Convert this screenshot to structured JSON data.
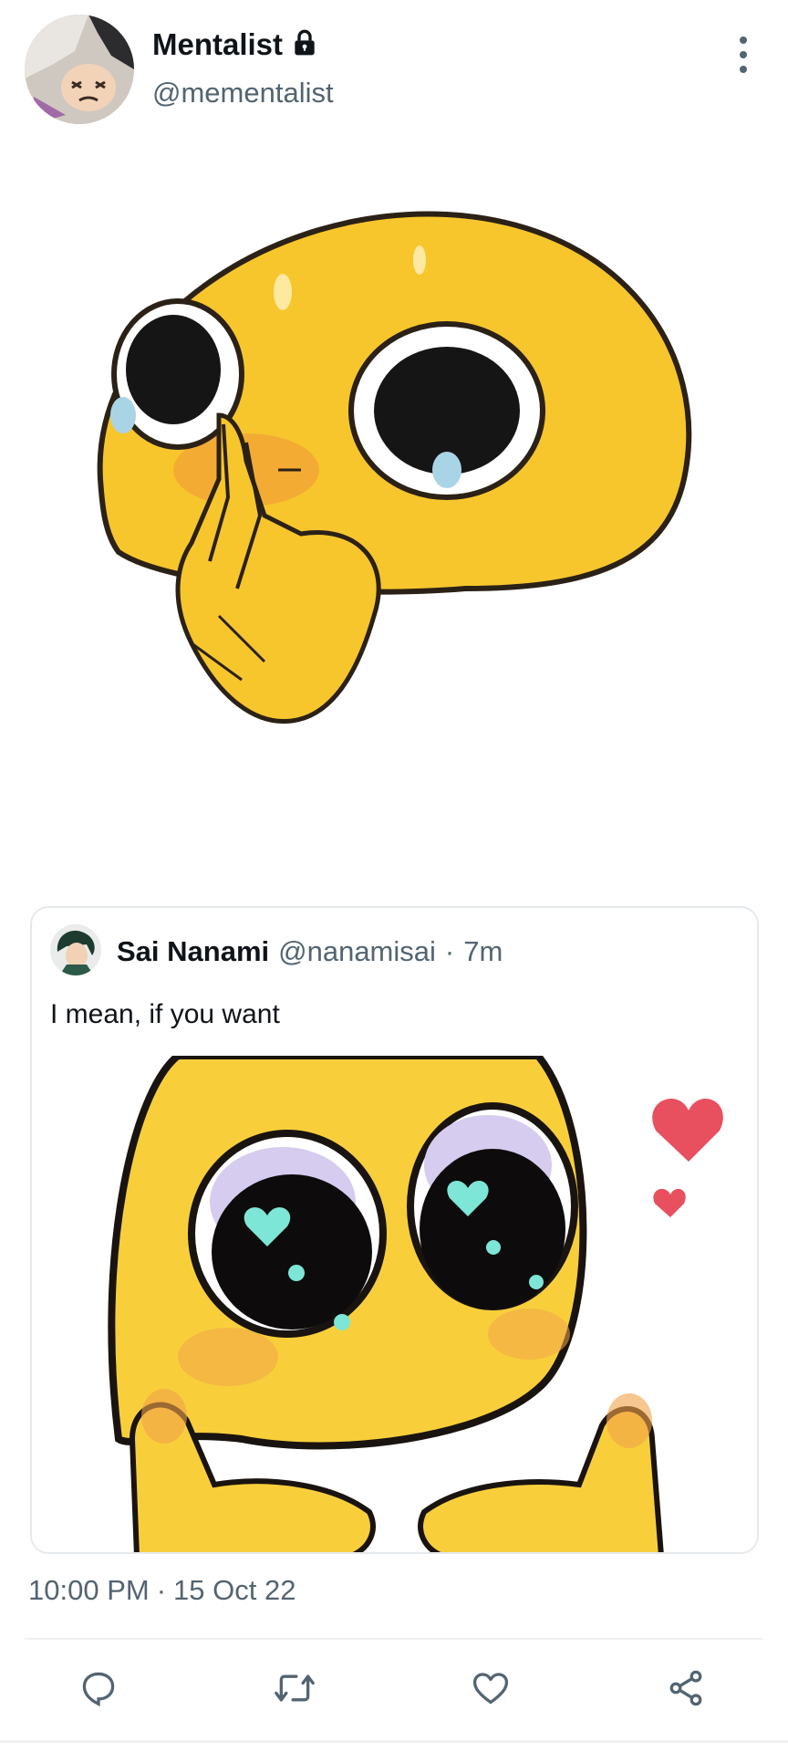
{
  "author": {
    "display_name": "Mentalist",
    "handle": "@mementalist",
    "protected": true,
    "icon": "lock-icon"
  },
  "menu": {
    "icon": "more-vertical-icon"
  },
  "main_image": {
    "subject": "yellow blob emoji with big teary eyes pressing hands together"
  },
  "quote": {
    "display_name": "Sai Nanami",
    "handle": "@nanamisai",
    "separator": "·",
    "time": "7m",
    "text": "I mean, if you want",
    "image": {
      "subject": "yellow blob emoji with sparkling eyes, hearts and pointing fingers"
    }
  },
  "meta": {
    "time": "10:00 PM",
    "separator": "·",
    "date": "15 Oct 22"
  },
  "actions": [
    {
      "name": "reply",
      "icon": "reply-icon"
    },
    {
      "name": "retweet",
      "icon": "retweet-icon"
    },
    {
      "name": "like",
      "icon": "heart-icon"
    },
    {
      "name": "share",
      "icon": "share-icon"
    }
  ],
  "colors": {
    "text_primary": "#0f1419",
    "text_secondary": "#536471",
    "border": "#e6e9ec",
    "emoji_yellow": "#f7c62c",
    "heart": "#e8505f"
  }
}
